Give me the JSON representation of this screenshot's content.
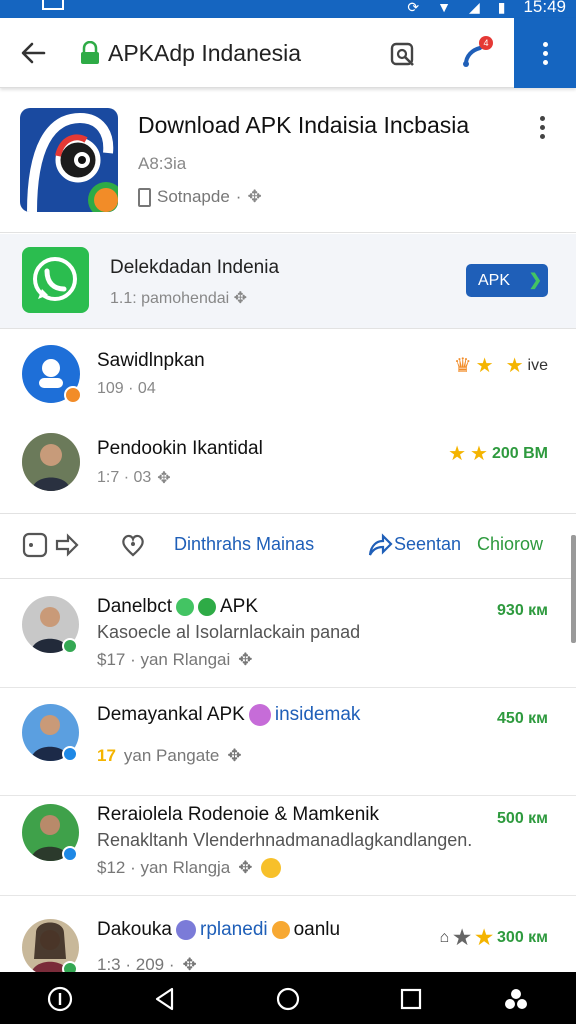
{
  "status_bar": {
    "time": "15:49"
  },
  "app_bar": {
    "title": "APKAdp Indanesia",
    "notification_count": "4"
  },
  "hero": {
    "title": "Download APK Indaisia Incbasia",
    "version": "A8:3ia",
    "developer": "Sotnapde"
  },
  "promo": {
    "name": "Delekdadan Indenia",
    "meta": "1.1: pamohendai",
    "button_label": "APK"
  },
  "featured": [
    {
      "name": "Sawidlnpkan",
      "meta": "109 · 04",
      "right_text": "ive"
    },
    {
      "name": "Pendookin Ikantidal",
      "meta": "1:7 · 03",
      "right_text": "200 ВМ"
    }
  ],
  "actions": {
    "trending_label": "Dinthrahs Mainas",
    "share_label": "Seentan",
    "follow_label": "Chiorow"
  },
  "list": [
    {
      "name": "Danelbct",
      "tag": "APK",
      "desc": "Kasoecle al Isolarnlackain panad",
      "meta": "$17 · yan Rlangai",
      "size": "930 км",
      "badge_color": "#34a853"
    },
    {
      "name": "Demayankal APK",
      "tag": "insidemak",
      "desc": "",
      "meta": "yan Pangate",
      "meta_prefix": "17",
      "size": "450 км",
      "badge_color": "#1e88e5"
    },
    {
      "name": "Reraiolela Rodenoie & Mamkenik",
      "tag": "",
      "desc": "Renakltanh Vlenderhnadmanadlagkandlangen.",
      "meta": "$12 · yan Rlangja",
      "size": "500 км",
      "badge_color": "#1e88e5"
    },
    {
      "name": "Dakouka",
      "tag": "rplanedi",
      "tag2": "oanlu",
      "desc": "",
      "meta": "1:3 · 209 ·",
      "size": "300 км",
      "badge_color": "#34a853"
    }
  ],
  "colors": {
    "primary": "#1565c0",
    "accent_green": "#2e9a3e",
    "star": "#f4b400"
  }
}
